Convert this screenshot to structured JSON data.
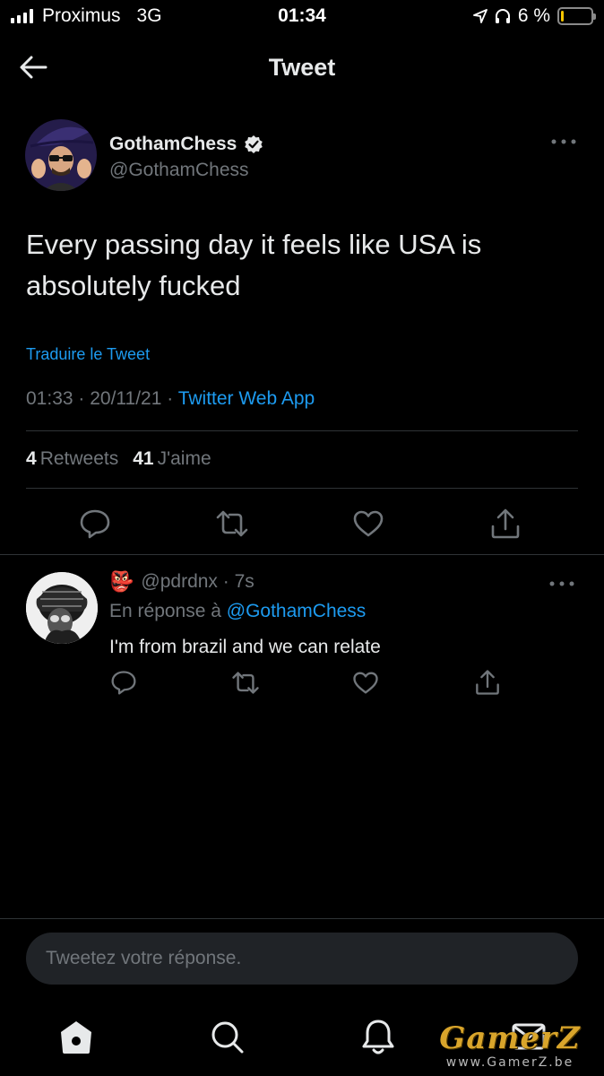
{
  "status_bar": {
    "carrier": "Proximus",
    "network": "3G",
    "time": "01:34",
    "battery_percent_label": "6 %",
    "battery_level": 0.06,
    "battery_color": "#f7c600"
  },
  "header": {
    "title": "Tweet"
  },
  "tweet": {
    "author_name": "GothamChess",
    "author_handle": "@GothamChess",
    "verified": true,
    "text": "Every passing day it feels like USA is absolutely fucked",
    "translate_label": "Traduire le Tweet",
    "timestamp": "01:33 · 20/11/21 · ",
    "source": "Twitter Web App",
    "retweets_count": "4",
    "retweets_label": "Retweets",
    "likes_count": "41",
    "likes_label": "J'aime"
  },
  "reply": {
    "emoji": "👺",
    "handle_time": "@pdrdnx · 7s",
    "in_reply_prefix": "En réponse à ",
    "in_reply_mention": "@GothamChess",
    "text": "I'm from brazil and we can relate"
  },
  "compose": {
    "placeholder": "Tweetez votre réponse."
  },
  "watermark": {
    "logo": "GamerZ",
    "url": "www.GamerZ.be"
  },
  "colors": {
    "background": "#000000",
    "accent_blue": "#1d9bf0",
    "muted_text": "#71767b",
    "primary_text": "#e7e9ea",
    "divider": "#2f3336"
  },
  "icons": {
    "back": "arrow-left-icon",
    "verified": "verified-badge-icon",
    "more": "more-horizontal-icon",
    "reply": "reply-icon",
    "retweet": "retweet-icon",
    "like": "heart-icon",
    "share": "share-icon",
    "tab_home": "home-icon",
    "tab_search": "search-icon",
    "tab_notifications": "bell-icon",
    "tab_messages": "envelope-icon"
  }
}
